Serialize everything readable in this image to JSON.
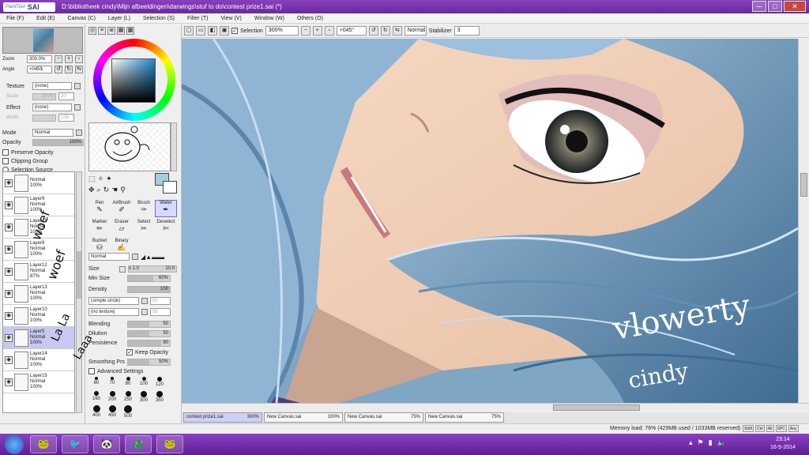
{
  "window": {
    "app_logo_small": "PaintTool",
    "app_logo": "SAI",
    "title": "D:\\bibliotheek cindy\\Mijn afbeeldingen\\darwings\\stuf to do\\contest prize1.sai (*)",
    "buttons": [
      "─",
      "□",
      "✕"
    ]
  },
  "menu": [
    "File (F)",
    "Edit (E)",
    "Canvas (C)",
    "Layer (L)",
    "Selection (S)",
    "Filter (T)",
    "View (V)",
    "Window (W)",
    "Others (O)"
  ],
  "toolbar": {
    "selection_label": "Selection",
    "selection_checked": true,
    "zoom": "300%",
    "angle": "+045°",
    "blend": "Normal",
    "stabilizer_label": "Stabilizer",
    "stabilizer": "3"
  },
  "navigator": {
    "zoom_label": "Zoom",
    "zoom_value": "300.0%",
    "angle_label": "Angle",
    "angle_value": "+045$"
  },
  "layer_panel": {
    "texture_label": "Texture",
    "texture_value": "(none)",
    "texture_scale_label": "Scale",
    "texture_scale_value": "100%",
    "texture_scale_num": "20",
    "effect_label": "Effect",
    "effect_value": "(none)",
    "effect_width_label": "Width",
    "effect_width_value": "1",
    "effect_width_num": "100",
    "mode_label": "Mode",
    "mode_value": "Normal",
    "opacity_label": "Opacity",
    "opacity_value": "100%",
    "preserve_opacity": "Preserve Opacity",
    "clipping_group": "Clipping Group",
    "selection_source": "Selection Source"
  },
  "layers": [
    {
      "name": "Normal",
      "mode": "100%",
      "opacity": "",
      "selected": false
    },
    {
      "name": "Layer9",
      "mode": "Normal",
      "opacity": "100%",
      "selected": false
    },
    {
      "name": "Layer11",
      "mode": "Normal",
      "opacity": "100%",
      "selected": false
    },
    {
      "name": "Layer8",
      "mode": "Normal",
      "opacity": "100%",
      "selected": false
    },
    {
      "name": "Layer12",
      "mode": "Normal",
      "opacity": "87%",
      "selected": false
    },
    {
      "name": "Layer13",
      "mode": "Normal",
      "opacity": "100%",
      "selected": false
    },
    {
      "name": "Layer10",
      "mode": "Normal",
      "opacity": "100%",
      "selected": false
    },
    {
      "name": "Layer5",
      "mode": "Normal",
      "opacity": "100%",
      "selected": true
    },
    {
      "name": "Layer14",
      "mode": "Normal",
      "opacity": "100%",
      "selected": false
    },
    {
      "name": "Layer15",
      "mode": "Normal",
      "opacity": "100%",
      "selected": false
    }
  ],
  "tools": [
    {
      "label": "Pen",
      "icon": "pen-icon",
      "glyph": "✎",
      "selected": false
    },
    {
      "label": "AirBrush",
      "icon": "airbrush-icon",
      "glyph": "✐",
      "selected": false
    },
    {
      "label": "Brush",
      "icon": "brush-icon",
      "glyph": "✑",
      "selected": false
    },
    {
      "label": "Water",
      "icon": "water-icon",
      "glyph": "✒",
      "selected": true
    },
    {
      "label": "Marker",
      "icon": "marker-icon",
      "glyph": "✏",
      "selected": false
    },
    {
      "label": "Eraser",
      "icon": "eraser-icon",
      "glyph": "▱",
      "selected": false
    },
    {
      "label": "Select",
      "icon": "select-icon",
      "glyph": "✂",
      "selected": false
    },
    {
      "label": "Deselect",
      "icon": "deselect-icon",
      "glyph": "✄",
      "selected": false
    },
    {
      "label": "Bucket",
      "icon": "bucket-icon",
      "glyph": "⛁",
      "selected": false
    },
    {
      "label": "Binary",
      "icon": "binary-icon",
      "glyph": "✍",
      "selected": false
    }
  ],
  "tool_options": {
    "blend": "Normal",
    "size_label": "Size",
    "size_mult": "x 1.0",
    "size_value": "10.0",
    "min_size_label": "Min Size",
    "min_size_value": "60%",
    "min_size_fraction": 0.6,
    "density_label": "Density",
    "density_value": "100",
    "shape": "(simple circle)",
    "shape_num": "50",
    "texture": "(no texture)",
    "texture_num": "95",
    "blending_label": "Blending",
    "blending_value": "50",
    "dilution_label": "Dilution",
    "dilution_value": "50",
    "persistence_label": "Persistence",
    "persistence_value": "80",
    "keep_opacity": "Keep Opacity",
    "smoothing_label": "Smoothing Prs",
    "smoothing_value": "50%",
    "advanced": "Advanced Settings"
  },
  "brush_sizes": [
    "60",
    "70",
    "80",
    "100",
    "120",
    "160",
    "200",
    "250",
    "300",
    "350",
    "400",
    "450",
    "500"
  ],
  "tabs": [
    {
      "name": "contest prize1.sai",
      "zoom": "300%",
      "active": true
    },
    {
      "name": "New Canvas.sai",
      "zoom": "100%",
      "active": false
    },
    {
      "name": "New Canvas.sai",
      "zoom": "75%",
      "active": false
    },
    {
      "name": "New Canvas.sai",
      "zoom": "75%",
      "active": false
    }
  ],
  "status": {
    "memory": "Memory load: 76% (429MB used / 1033MB reserved)",
    "keys": [
      "Shift",
      "Ctrl",
      "Alt",
      "SPC",
      "Any"
    ]
  },
  "taskbar": {
    "time": "23:14",
    "date": "16-5-2014",
    "apps": [
      "🐸",
      "🐦",
      "🐼",
      "🐉",
      "🐸"
    ]
  },
  "canvas_signature": {
    "line1": "vlowerty",
    "line2": "cindy"
  },
  "doodles": {
    "line1": "woef",
    "line2": "woef",
    "line3": "La La",
    "line4": "Laaa"
  },
  "colors": {
    "title_bar": "#7a34b0",
    "hair": "#8fb4d4",
    "skin": "#f2cfb7",
    "selected_layer": "#c9c8f2"
  }
}
